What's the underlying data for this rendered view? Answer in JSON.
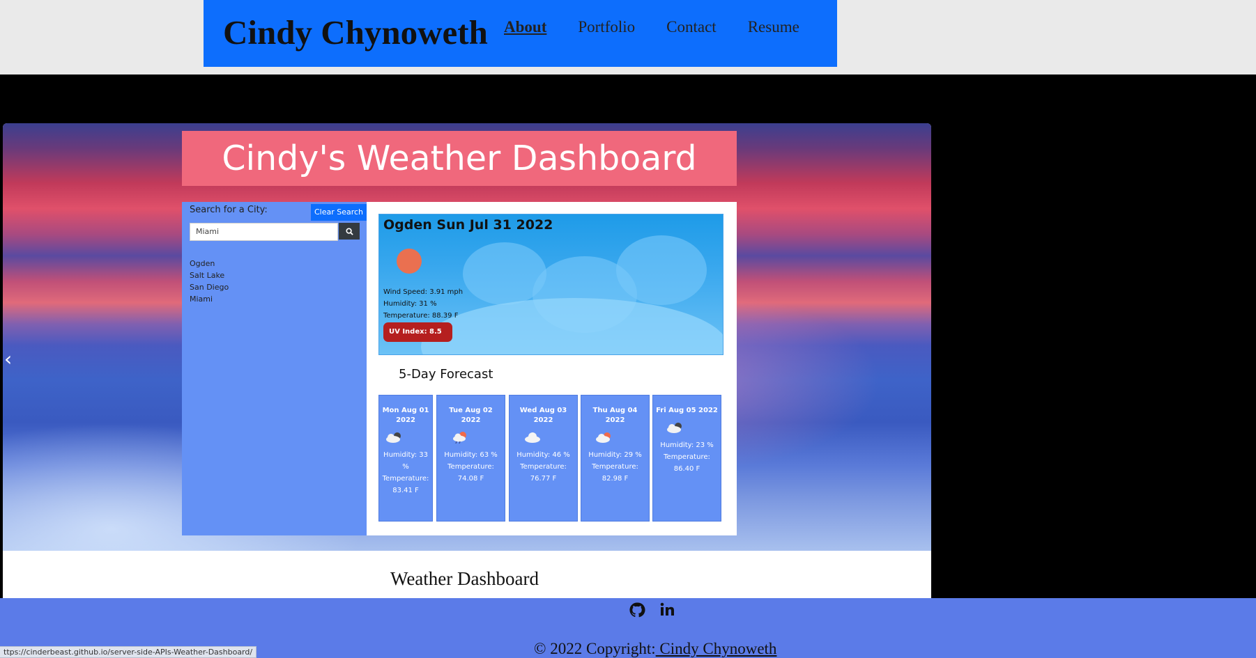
{
  "header": {
    "site_name": "Cindy Chynoweth",
    "nav": [
      "About",
      "Portfolio",
      "Contact",
      "Resume"
    ],
    "active_nav": "About"
  },
  "carousel": {
    "app": {
      "title": "Cindy's Weather Dashboard",
      "search_label": "Search for a City:",
      "clear_button": "Clear Search",
      "search_value": "Miami",
      "history": [
        "Ogden",
        "Salt Lake",
        "San Diego",
        "Miami"
      ],
      "current": {
        "title": "Ogden Sun Jul 31 2022",
        "wind": "Wind Speed: 3.91 mph",
        "humidity": "Humidity: 31 %",
        "temperature": "Temperature: 88.39 F",
        "uv": "UV Index: 8.5"
      },
      "forecast_title": "5-Day Forecast",
      "forecast": [
        {
          "date": "Mon Aug 01 2022",
          "humidity": "Humidity: 33 %",
          "temperature": "Temperature: 83.41 F",
          "icon": "cloud-icon"
        },
        {
          "date": "Tue Aug 02 2022",
          "humidity": "Humidity: 63 %",
          "temperature": "Temperature: 74.08 F",
          "icon": "cloud-sun-icon"
        },
        {
          "date": "Wed Aug 03 2022",
          "humidity": "Humidity: 46 %",
          "temperature": "Temperature: 76.77 F",
          "icon": "cloud-icon"
        },
        {
          "date": "Thu Aug 04 2022",
          "humidity": "Humidity: 29 %",
          "temperature": "Temperature: 82.98 F",
          "icon": "cloud-sun-icon"
        },
        {
          "date": "Fri Aug 05 2022",
          "humidity": "Humidity: 23 %",
          "temperature": "Temperature: 86.40 F",
          "icon": "cloud-icon"
        }
      ]
    },
    "caption": "Weather Dashboard"
  },
  "footer": {
    "icons": [
      "github-icon",
      "linkedin-icon"
    ],
    "copyright_prefix": "© 2022 Copyright:",
    "copyright_name": " Cindy Chynoweth"
  },
  "status_bar": "ttps://cinderbeast.github.io/server-side-APIs-Weather-Dashboard/",
  "colors": {
    "header_bg": "#0d6efd",
    "app_title_bg": "#f0687c",
    "sidebar_bg": "#6491f5",
    "uv_bg": "#b51f1f",
    "footer_bg": "#5b7be8"
  }
}
